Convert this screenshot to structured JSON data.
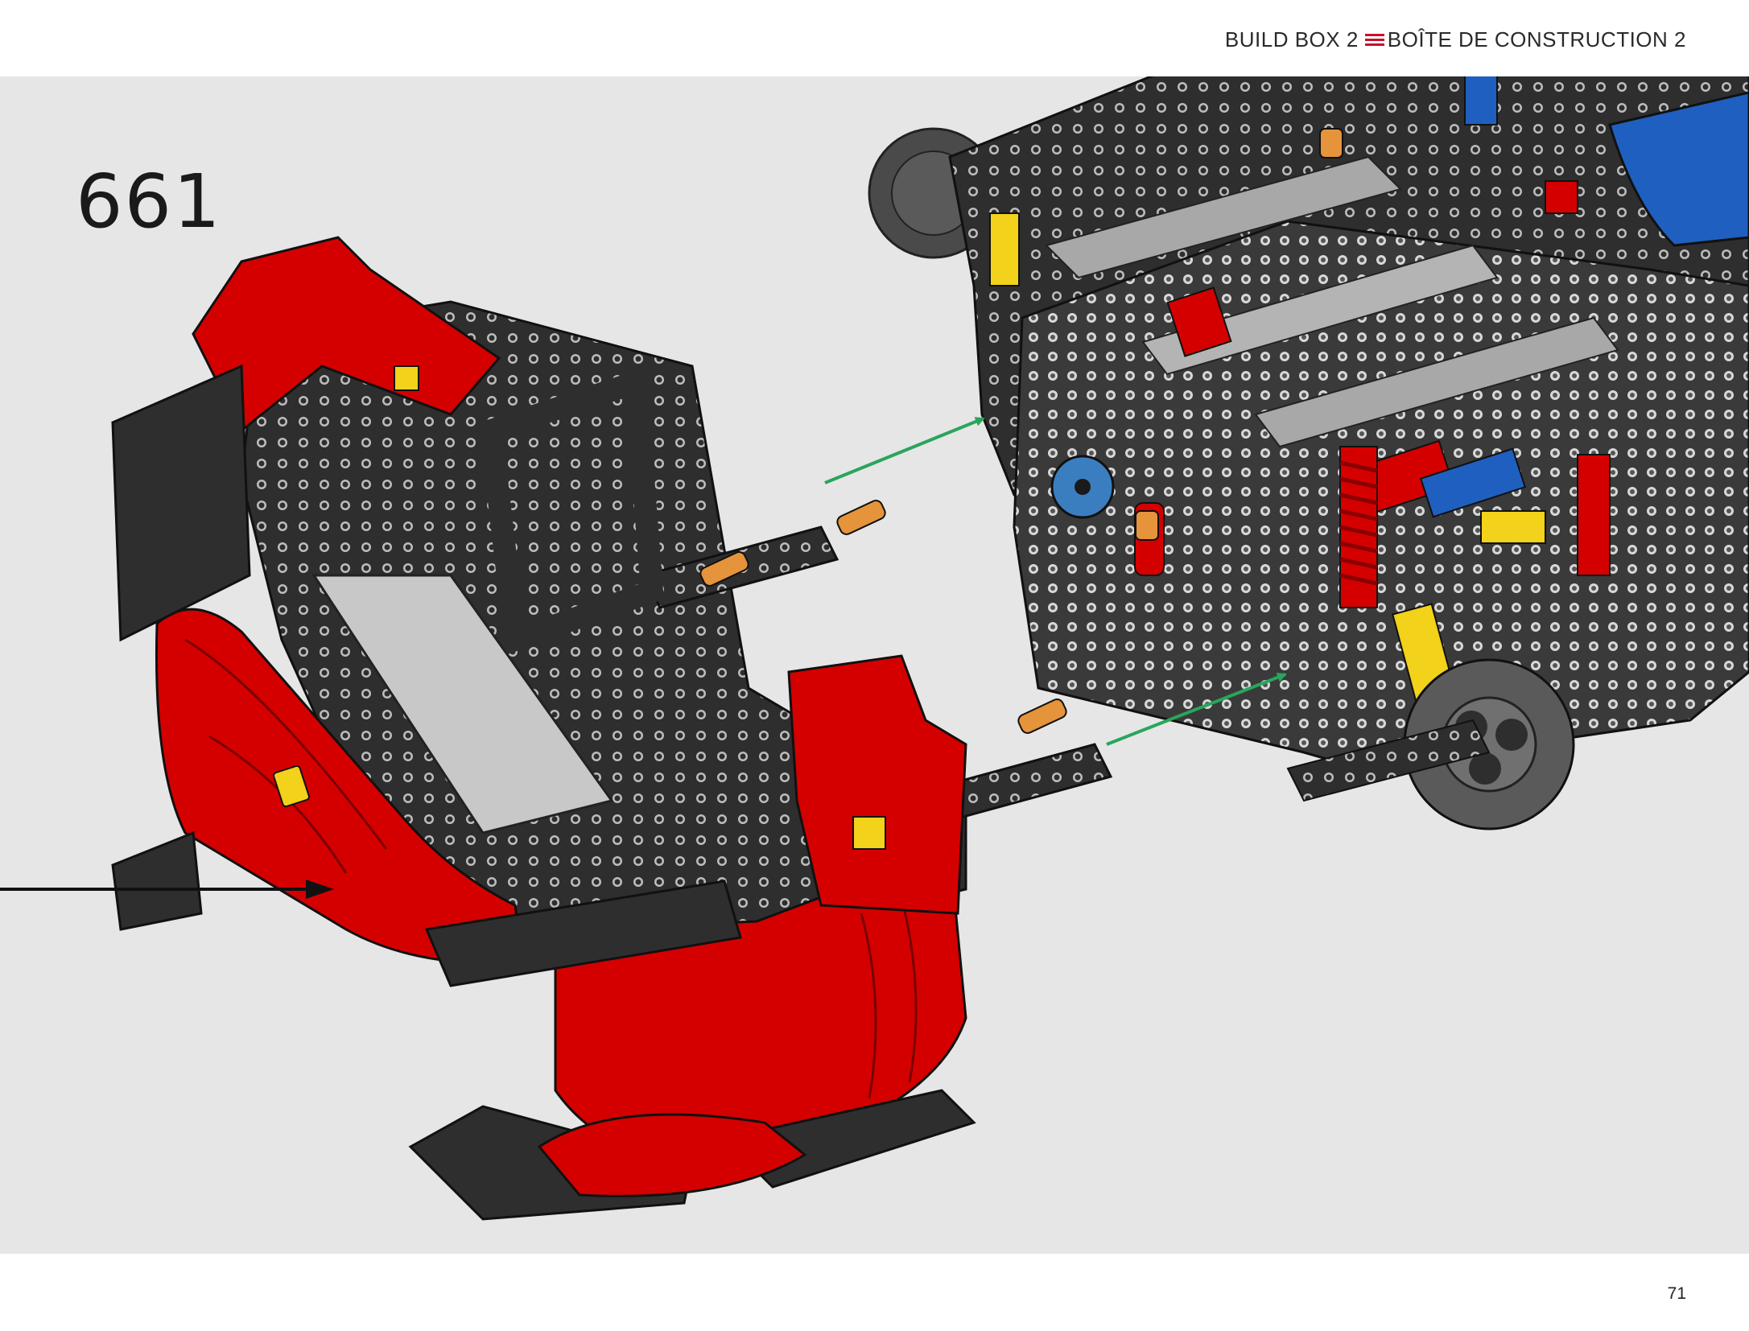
{
  "header": {
    "build_box": "BUILD BOX 2",
    "build_box_fr": "BOÎTE DE CONSTRUCTION 2",
    "separator_icon": "three-red-lines-icon",
    "accent_color": "#c8102e"
  },
  "step": {
    "number": "661"
  },
  "illustration": {
    "subject": "technic-car-front-module-assembly",
    "arrow_color": "#2aa55c",
    "pointer_color": "#111111",
    "colors": {
      "red": "#d40000",
      "dark_gray": "#2e2e2e",
      "light_gray": "#bdbdbd",
      "orange_pin": "#e5943b",
      "blue": "#1f5fbf",
      "yellow": "#f2d21a"
    }
  },
  "footer": {
    "page_number": "71"
  }
}
